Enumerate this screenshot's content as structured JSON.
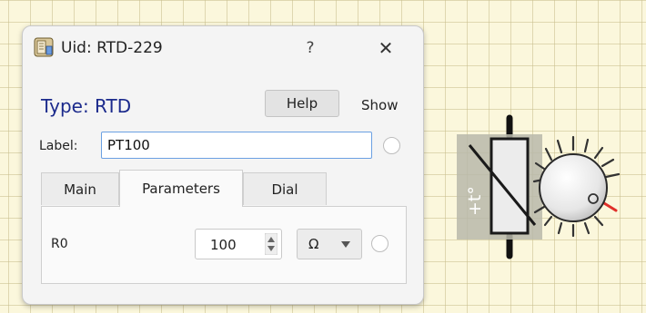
{
  "dialog": {
    "title": "Uid: RTD-229",
    "help_glyph": "?",
    "close_glyph": "✕",
    "icon": "component-icon"
  },
  "header": {
    "type_heading": "Type: RTD",
    "help_button": "Help",
    "show_label": "Show"
  },
  "label_field": {
    "caption": "Label:",
    "value": "PT100"
  },
  "tabs": [
    {
      "label": "Main",
      "active": false
    },
    {
      "label": "Parameters",
      "active": true
    },
    {
      "label": "Dial",
      "active": false
    }
  ],
  "parameters": {
    "rows": [
      {
        "name": "R0",
        "value": "100",
        "unit": "Ω"
      }
    ]
  },
  "canvas": {
    "component_symbol": "+t°"
  },
  "colors": {
    "title_blue": "#1b2a8c",
    "focus_border": "#6ba0e2",
    "dial_pointer": "#e0302a",
    "grid_background": "#fbf7dc"
  }
}
